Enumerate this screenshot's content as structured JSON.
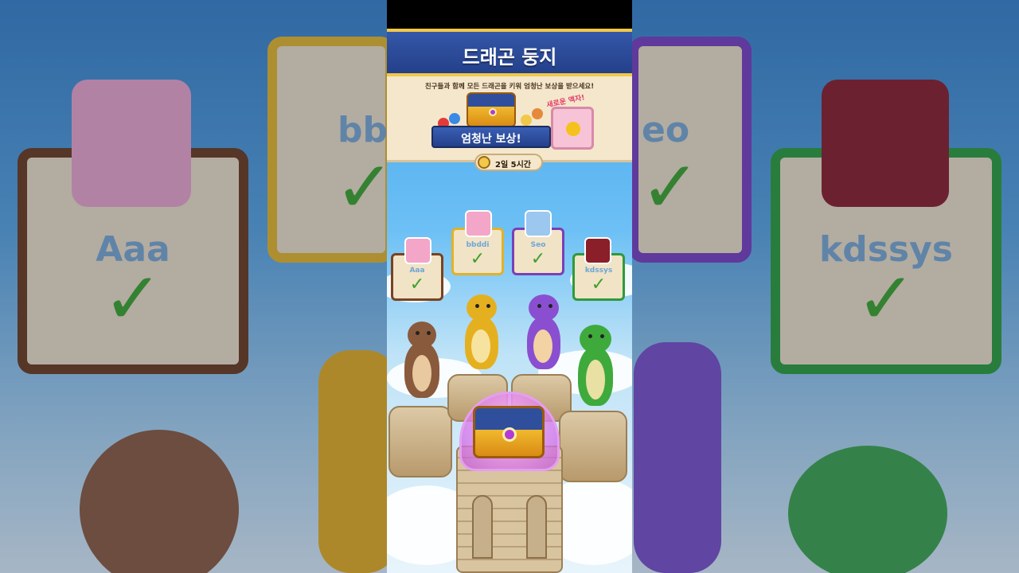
{
  "game": {
    "title": "드래곤 둥지",
    "subtitle": "친구들과 함께 모든 드래곤을 키워 엄청난 보상을 받으세요!",
    "reward_label": "엄청난 보상!",
    "new_tag": "새로운 액자!",
    "timer": "2일 5시간",
    "players": [
      {
        "name": "Aaa",
        "status": "complete",
        "frame_color": "#7a4220"
      },
      {
        "name": "bbddi",
        "status": "complete",
        "frame_color": "#e0b22a"
      },
      {
        "name": "Seo",
        "status": "complete",
        "frame_color": "#7a3fb8"
      },
      {
        "name": "kdssys",
        "status": "complete",
        "frame_color": "#2f9a3a"
      }
    ],
    "dragons": [
      "brown-dragon",
      "yellow-dragon",
      "purple-dragon",
      "green-dragon"
    ]
  },
  "background": {
    "names": [
      "Aaa",
      "bbc",
      "eo",
      "kdssys"
    ]
  },
  "colors": {
    "header_blue": "#2b4a98",
    "gold_border": "#f1c84a",
    "banner_bg": "#f4e7cc",
    "check_green": "#3fa02a"
  }
}
